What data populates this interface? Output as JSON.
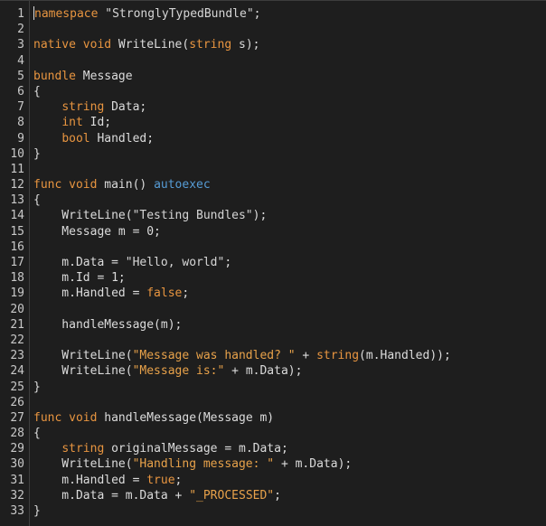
{
  "line_numbers": [
    "1",
    "2",
    "3",
    "4",
    "5",
    "6",
    "7",
    "8",
    "9",
    "10",
    "11",
    "12",
    "13",
    "14",
    "15",
    "16",
    "17",
    "18",
    "19",
    "20",
    "21",
    "22",
    "23",
    "24",
    "25",
    "26",
    "27",
    "28",
    "29",
    "30",
    "31",
    "32",
    "33"
  ],
  "lines": [
    [
      {
        "t": "namespace",
        "c": "kw"
      },
      {
        "t": " ",
        "c": "ident"
      },
      {
        "t": "\"StronglyTypedBundle\"",
        "c": "str-w"
      },
      {
        "t": ";",
        "c": "ident"
      }
    ],
    [],
    [
      {
        "t": "native",
        "c": "kw"
      },
      {
        "t": " ",
        "c": "ident"
      },
      {
        "t": "void",
        "c": "kw"
      },
      {
        "t": " WriteLine(",
        "c": "ident"
      },
      {
        "t": "string",
        "c": "kw"
      },
      {
        "t": " s);",
        "c": "ident"
      }
    ],
    [],
    [
      {
        "t": "bundle",
        "c": "kw"
      },
      {
        "t": " Message",
        "c": "ident"
      }
    ],
    [
      {
        "t": "{",
        "c": "ident"
      }
    ],
    [
      {
        "t": "    ",
        "c": "ident"
      },
      {
        "t": "string",
        "c": "kw"
      },
      {
        "t": " Data;",
        "c": "ident"
      }
    ],
    [
      {
        "t": "    ",
        "c": "ident"
      },
      {
        "t": "int",
        "c": "kw"
      },
      {
        "t": " Id;",
        "c": "ident"
      }
    ],
    [
      {
        "t": "    ",
        "c": "ident"
      },
      {
        "t": "bool",
        "c": "kw"
      },
      {
        "t": " Handled;",
        "c": "ident"
      }
    ],
    [
      {
        "t": "}",
        "c": "ident"
      }
    ],
    [],
    [
      {
        "t": "func",
        "c": "kw"
      },
      {
        "t": " ",
        "c": "ident"
      },
      {
        "t": "void",
        "c": "kw"
      },
      {
        "t": " main() ",
        "c": "ident"
      },
      {
        "t": "autoexec",
        "c": "special"
      }
    ],
    [
      {
        "t": "{",
        "c": "ident"
      }
    ],
    [
      {
        "t": "    WriteLine(",
        "c": "ident"
      },
      {
        "t": "\"Testing Bundles\"",
        "c": "str-w"
      },
      {
        "t": ");",
        "c": "ident"
      }
    ],
    [
      {
        "t": "    Message m ",
        "c": "ident"
      },
      {
        "t": "=",
        "c": "op"
      },
      {
        "t": " 0;",
        "c": "ident"
      }
    ],
    [],
    [
      {
        "t": "    m.Data ",
        "c": "ident"
      },
      {
        "t": "=",
        "c": "op"
      },
      {
        "t": " ",
        "c": "ident"
      },
      {
        "t": "\"Hello, world\"",
        "c": "str-w"
      },
      {
        "t": ";",
        "c": "ident"
      }
    ],
    [
      {
        "t": "    m.Id ",
        "c": "ident"
      },
      {
        "t": "=",
        "c": "op"
      },
      {
        "t": " 1;",
        "c": "ident"
      }
    ],
    [
      {
        "t": "    m.Handled ",
        "c": "ident"
      },
      {
        "t": "=",
        "c": "op"
      },
      {
        "t": " ",
        "c": "ident"
      },
      {
        "t": "false",
        "c": "kw"
      },
      {
        "t": ";",
        "c": "ident"
      }
    ],
    [],
    [
      {
        "t": "    handleMessage(m);",
        "c": "ident"
      }
    ],
    [],
    [
      {
        "t": "    WriteLine(",
        "c": "ident"
      },
      {
        "t": "\"Message was handled? \"",
        "c": "str-o"
      },
      {
        "t": " + ",
        "c": "op"
      },
      {
        "t": "string",
        "c": "kw"
      },
      {
        "t": "(m.Handled));",
        "c": "ident"
      }
    ],
    [
      {
        "t": "    WriteLine(",
        "c": "ident"
      },
      {
        "t": "\"Message is:\"",
        "c": "str-o"
      },
      {
        "t": " + ",
        "c": "op"
      },
      {
        "t": "m.Data);",
        "c": "ident"
      }
    ],
    [
      {
        "t": "}",
        "c": "ident"
      }
    ],
    [],
    [
      {
        "t": "func",
        "c": "kw"
      },
      {
        "t": " ",
        "c": "ident"
      },
      {
        "t": "void",
        "c": "kw"
      },
      {
        "t": " handleMessage(Message m)",
        "c": "ident"
      }
    ],
    [
      {
        "t": "{",
        "c": "ident"
      }
    ],
    [
      {
        "t": "    ",
        "c": "ident"
      },
      {
        "t": "string",
        "c": "kw"
      },
      {
        "t": " originalMessage ",
        "c": "ident"
      },
      {
        "t": "=",
        "c": "op"
      },
      {
        "t": " m.Data;",
        "c": "ident"
      }
    ],
    [
      {
        "t": "    WriteLine(",
        "c": "ident"
      },
      {
        "t": "\"Handling message: \"",
        "c": "str-o"
      },
      {
        "t": " + ",
        "c": "op"
      },
      {
        "t": "m.Data);",
        "c": "ident"
      }
    ],
    [
      {
        "t": "    m.Handled ",
        "c": "ident"
      },
      {
        "t": "=",
        "c": "op"
      },
      {
        "t": " ",
        "c": "ident"
      },
      {
        "t": "true",
        "c": "kw"
      },
      {
        "t": ";",
        "c": "ident"
      }
    ],
    [
      {
        "t": "    m.Data ",
        "c": "ident"
      },
      {
        "t": "=",
        "c": "op"
      },
      {
        "t": " m.Data ",
        "c": "ident"
      },
      {
        "t": "+",
        "c": "op"
      },
      {
        "t": " ",
        "c": "ident"
      },
      {
        "t": "\"_PROCESSED\"",
        "c": "str-o"
      },
      {
        "t": ";",
        "c": "ident"
      }
    ],
    [
      {
        "t": "}",
        "c": "ident"
      }
    ]
  ],
  "colors": {
    "background": "#1e1e1e",
    "keyword": "#e89540",
    "string_light": "#d6d6d6",
    "string_orange": "#e8a24a",
    "identifier": "#dcdcdc",
    "special_keyword": "#569cd6",
    "line_number": "#c8c8c8"
  }
}
